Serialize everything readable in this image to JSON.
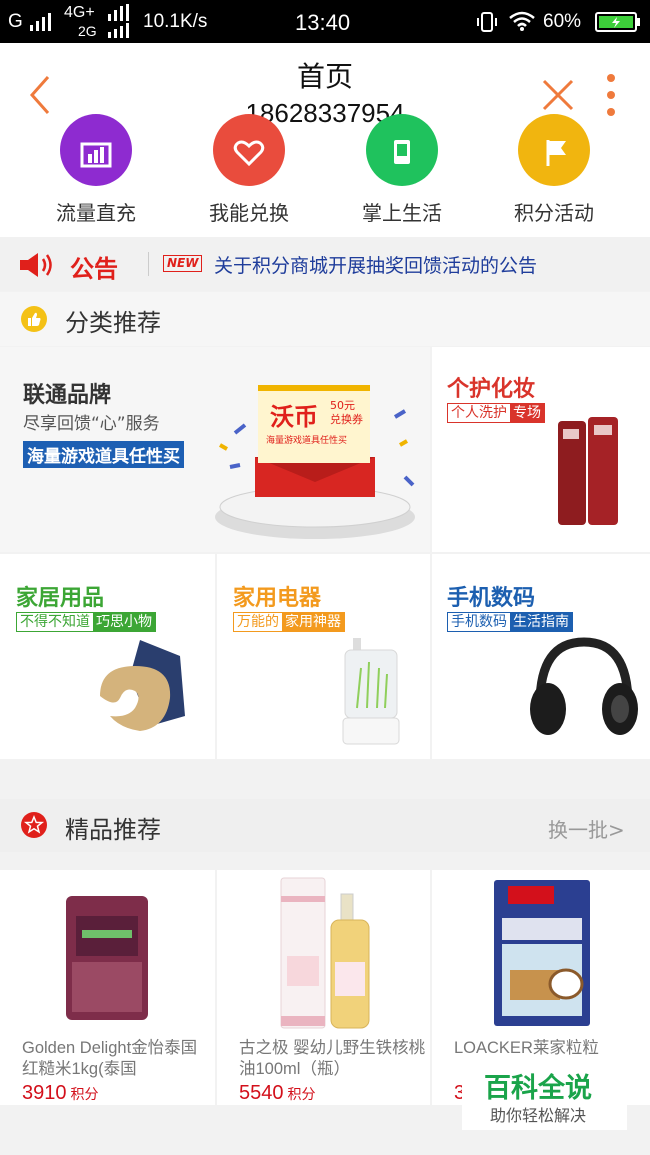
{
  "status_bar": {
    "carrier": "G",
    "net_top": "4G+",
    "net_bottom": "2G",
    "speed": "10.1K/s",
    "time": "13:40",
    "battery": "60%"
  },
  "navbar": {
    "title": "首页",
    "subtitle": "18628337954"
  },
  "quick_menu": [
    {
      "label": "流量直充",
      "color": "#8e2bd0",
      "icon": "chart-icon"
    },
    {
      "label": "我能兑换",
      "color": "#e94c3d",
      "icon": "shield-heart-icon"
    },
    {
      "label": "掌上生活",
      "color": "#1fc25d",
      "icon": "hand-phone-icon"
    },
    {
      "label": "积分活动",
      "color": "#f1b50f",
      "icon": "flag-icon"
    }
  ],
  "notice": {
    "label": "公告",
    "badge": "NEW",
    "text": "关于积分商城开展抽奖回馈活动的公告"
  },
  "category_section": {
    "title": "分类推荐"
  },
  "categories": {
    "unicom": {
      "title": "联通品牌",
      "subtitle": "尽享回馈“心”服务",
      "tag": "海量游戏道具任性买",
      "coupon_title": "沃币",
      "coupon_value": "50元",
      "coupon_sub": "兑换券",
      "coupon_desc": "海量游戏道具任性买"
    },
    "personal_care": {
      "title": "个护化妆",
      "tag_a": "个人洗护",
      "tag_b": "专场",
      "color": "#d9342b"
    },
    "home_goods": {
      "title": "家居用品",
      "tag_a": "不得不知道",
      "tag_b": "巧思小物",
      "color": "#3ca635"
    },
    "appliances": {
      "title": "家用电器",
      "tag_a": "万能的",
      "tag_b": "家用神器",
      "color": "#f39a1e"
    },
    "digital": {
      "title": "手机数码",
      "tag_a": "手机数码",
      "tag_b": "生活指南",
      "color": "#1c5fb0"
    }
  },
  "featured_section": {
    "title": "精品推荐",
    "refresh": "换一批>"
  },
  "products": [
    {
      "name": "Golden Delight金怡泰国红糙米1kg(泰国",
      "price": "3910",
      "unit": "积分"
    },
    {
      "name": "古之极 婴幼儿野生铁核桃油100ml（瓶）",
      "price": "5540",
      "unit": "积分"
    },
    {
      "name": "LOACKER莱家粒粒",
      "price": "3",
      "unit": ""
    }
  ],
  "watermark": {
    "title": "百科全说",
    "subtitle": "助你轻松解决"
  }
}
